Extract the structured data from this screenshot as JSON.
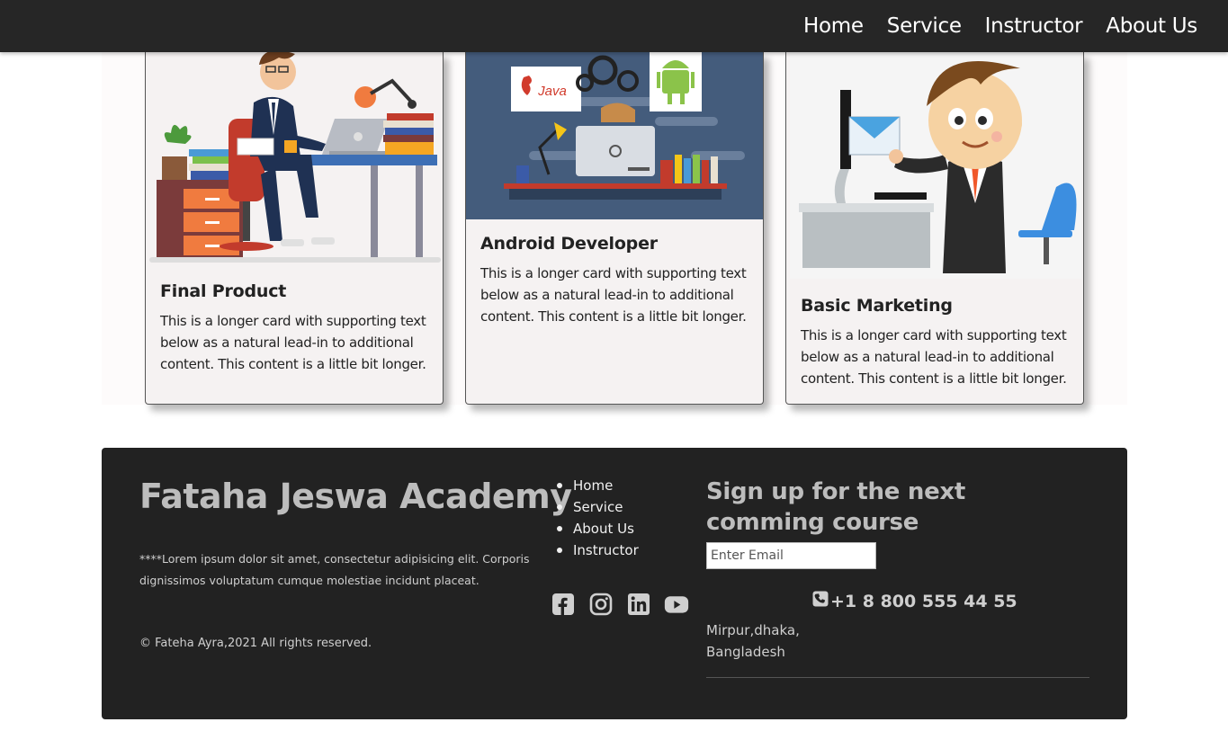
{
  "nav": {
    "links": [
      "Home",
      "Service",
      "Instructor",
      "About Us"
    ]
  },
  "cards": [
    {
      "title": "Final Product",
      "text": "This is a longer card with supporting text below as a natural lead-in to additional content. This content is a little bit longer.",
      "image_icon": "developer-at-desk-illustration"
    },
    {
      "title": "Android Developer",
      "text": "This is a longer card with supporting text below as a natural lead-in to additional content. This content is a little bit longer.",
      "image_icon": "coding-workspace-illustration",
      "image_labels": {
        "java": "Java"
      }
    },
    {
      "title": "Basic Marketing",
      "text": "This is a longer card with supporting text below as a natural lead-in to additional content. This content is a little bit longer.",
      "image_icon": "businessman-email-illustration"
    }
  ],
  "footer": {
    "brand": "Fataha Jeswa Academy",
    "lorem": "****Lorem ipsum dolor sit amet, consectetur adipisicing elit. Corporis dignissimos voluptatum cumque molestiae incidunt placeat.",
    "copyright": "© Fateha Ayra,2021 All rights reserved.",
    "links": [
      "Home",
      "Service",
      "About Us",
      "Instructor"
    ],
    "socials": [
      "facebook-icon",
      "instagram-icon",
      "linkedin-icon",
      "youtube-icon"
    ],
    "signup_title": "Sign up for the next comming course",
    "email_placeholder": "Enter Email",
    "phone": "+1 8 800 555 44 55",
    "address": "Mirpur,dhaka, Bangladesh"
  },
  "colors": {
    "navbar_bg": "#262626",
    "footer_bg": "#222222",
    "card_bg": "#f5f2f2"
  }
}
